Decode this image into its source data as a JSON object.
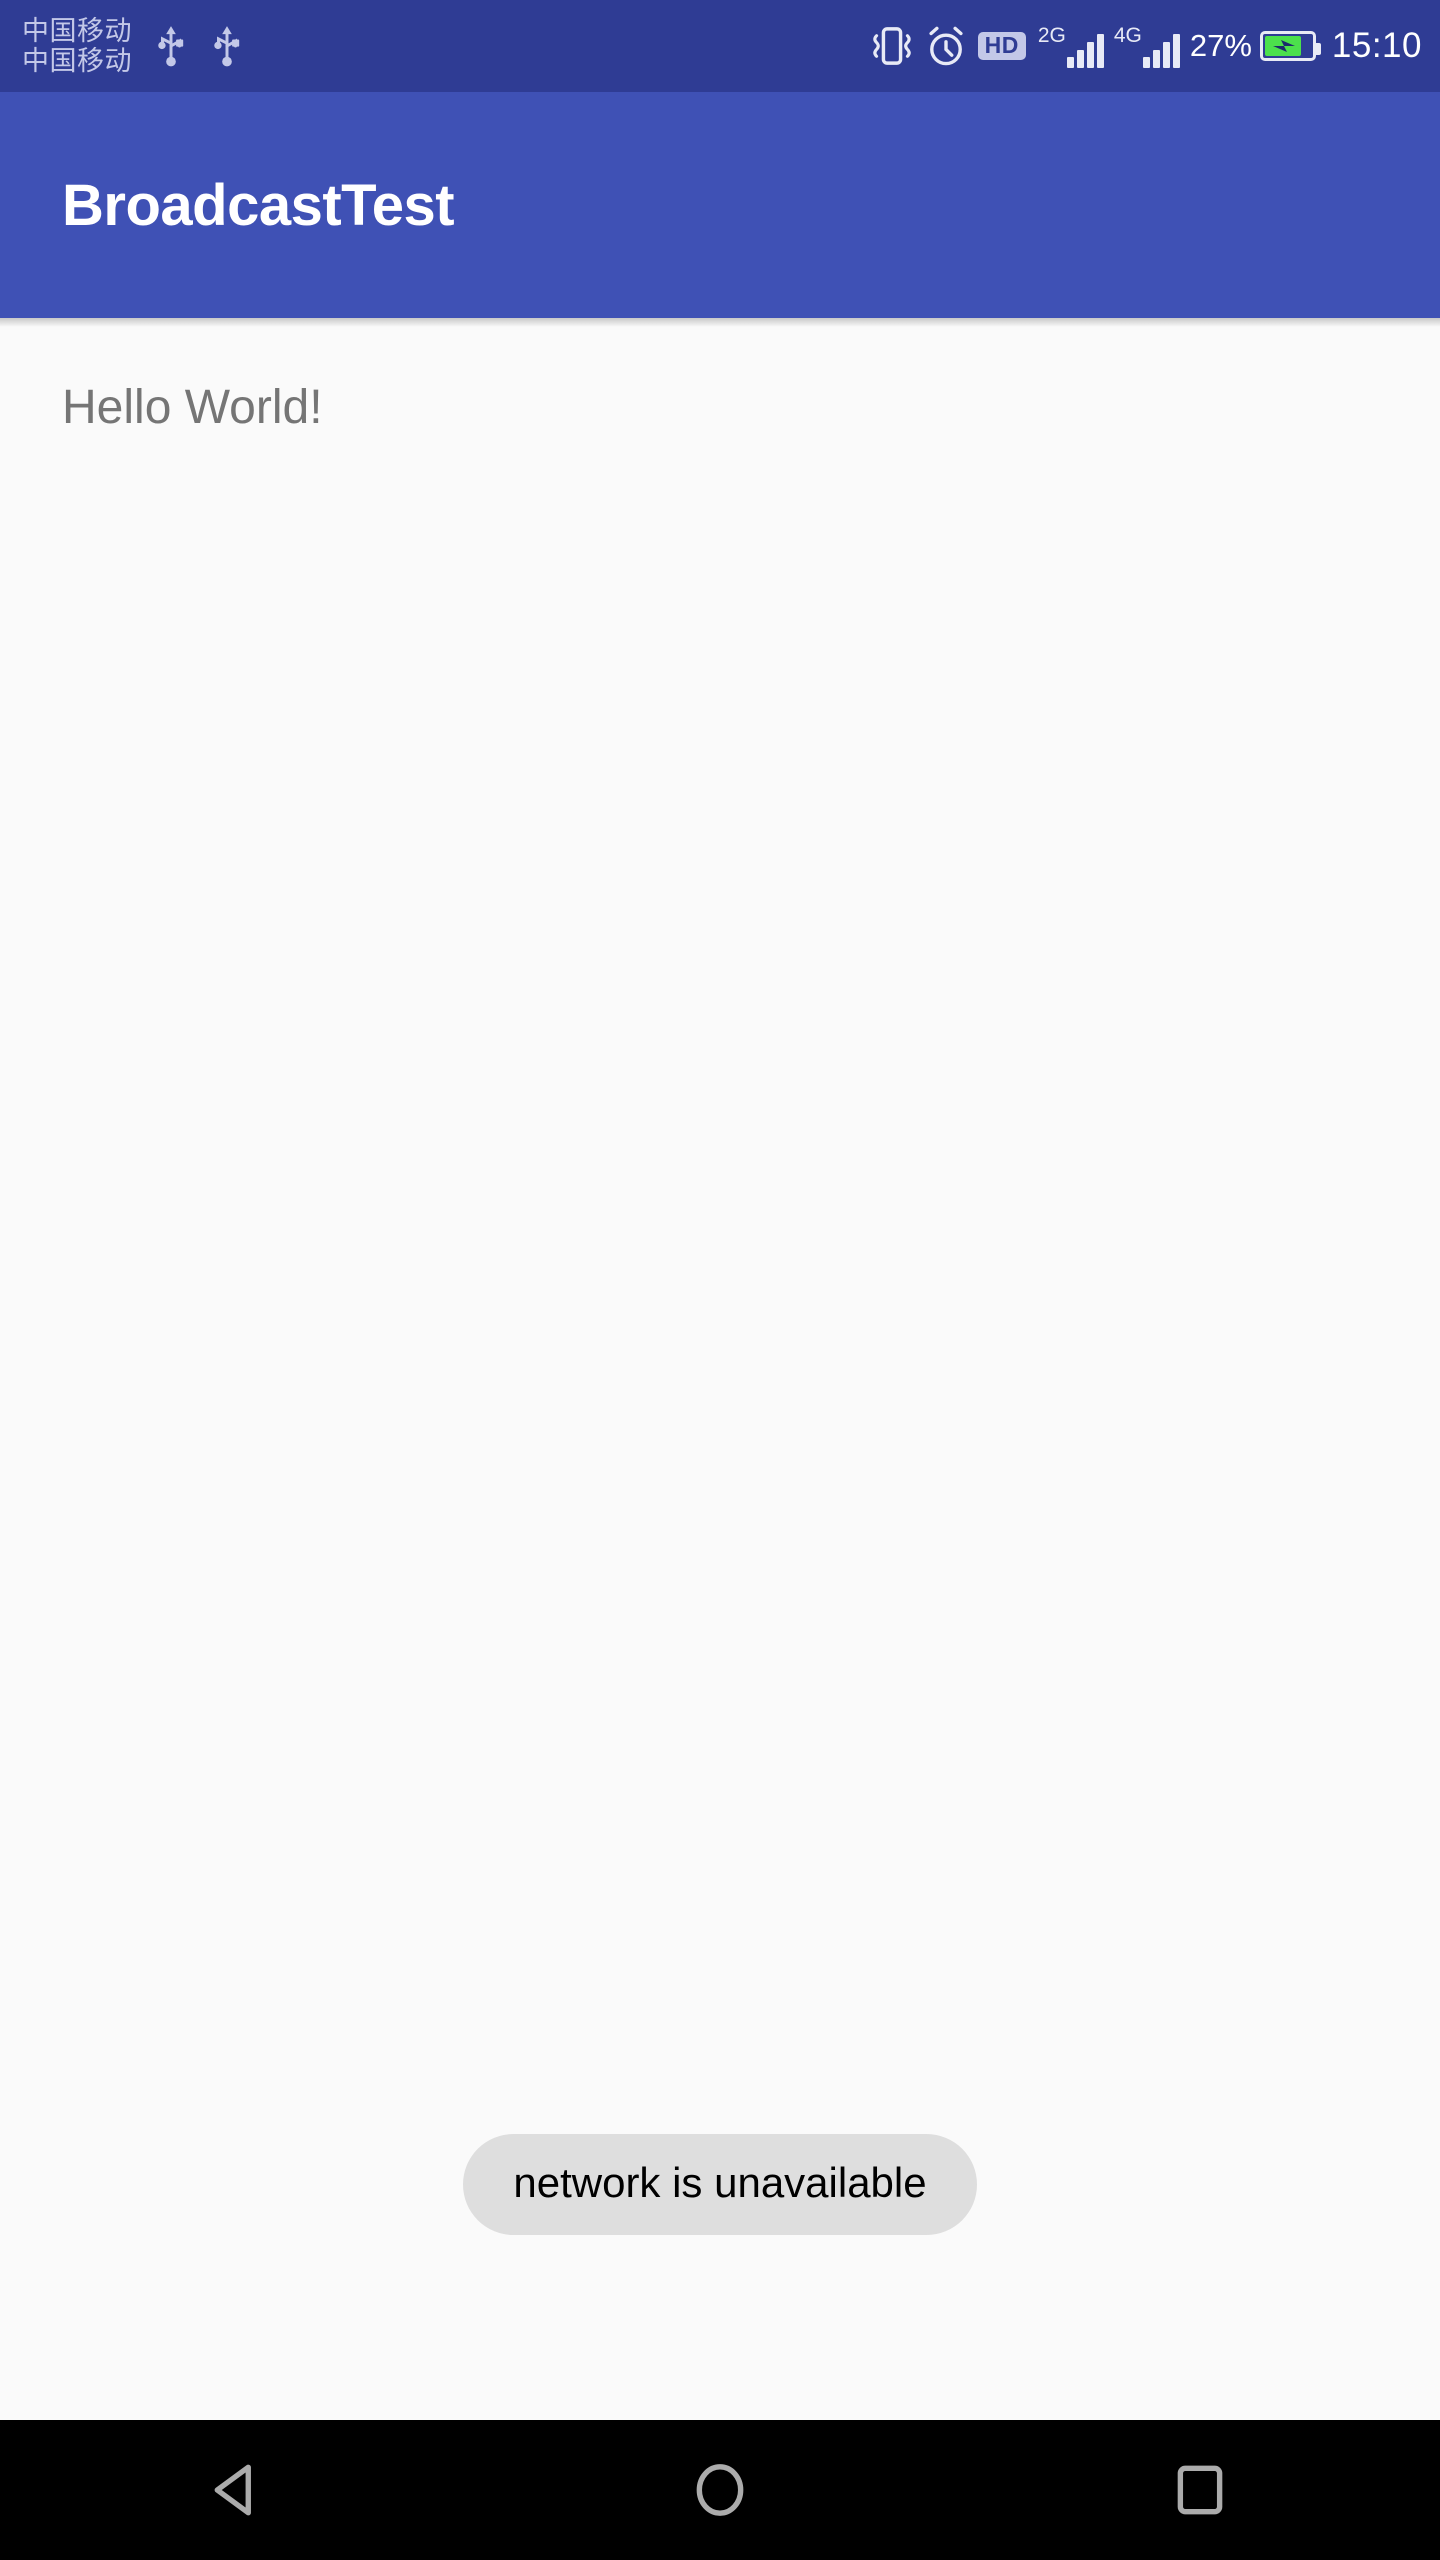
{
  "status_bar": {
    "background_color": "#2F3C94",
    "carriers": [
      "中国移动",
      "中国移动"
    ],
    "usb_icons": [
      "usb-icon",
      "usb-icon"
    ],
    "icons": [
      "vibrate-icon",
      "alarm-clock-icon"
    ],
    "hd_badge": "HD",
    "signals": [
      {
        "generation": "2G",
        "bars": 4
      },
      {
        "generation": "4G",
        "bars": 4
      }
    ],
    "battery_percent": "27%",
    "battery_state": "charging",
    "battery_color": "#4CE04C",
    "time": "15:10"
  },
  "app_bar": {
    "title": "BroadcastTest",
    "background_color": "#3F51B5",
    "text_color": "#FFFFFF"
  },
  "content": {
    "background_color": "#FAFAFA",
    "hello_text": "Hello World!",
    "hello_text_color": "#757575"
  },
  "toast": {
    "message": "network is unavailable",
    "background_color": "#DEDEDE",
    "text_color": "#000000"
  },
  "nav_bar": {
    "background_color": "#000000",
    "icon_color": "#ABABAB",
    "buttons": [
      {
        "name": "back-button",
        "icon": "triangle-left-icon"
      },
      {
        "name": "home-button",
        "icon": "circle-icon"
      },
      {
        "name": "recents-button",
        "icon": "square-icon"
      }
    ]
  }
}
